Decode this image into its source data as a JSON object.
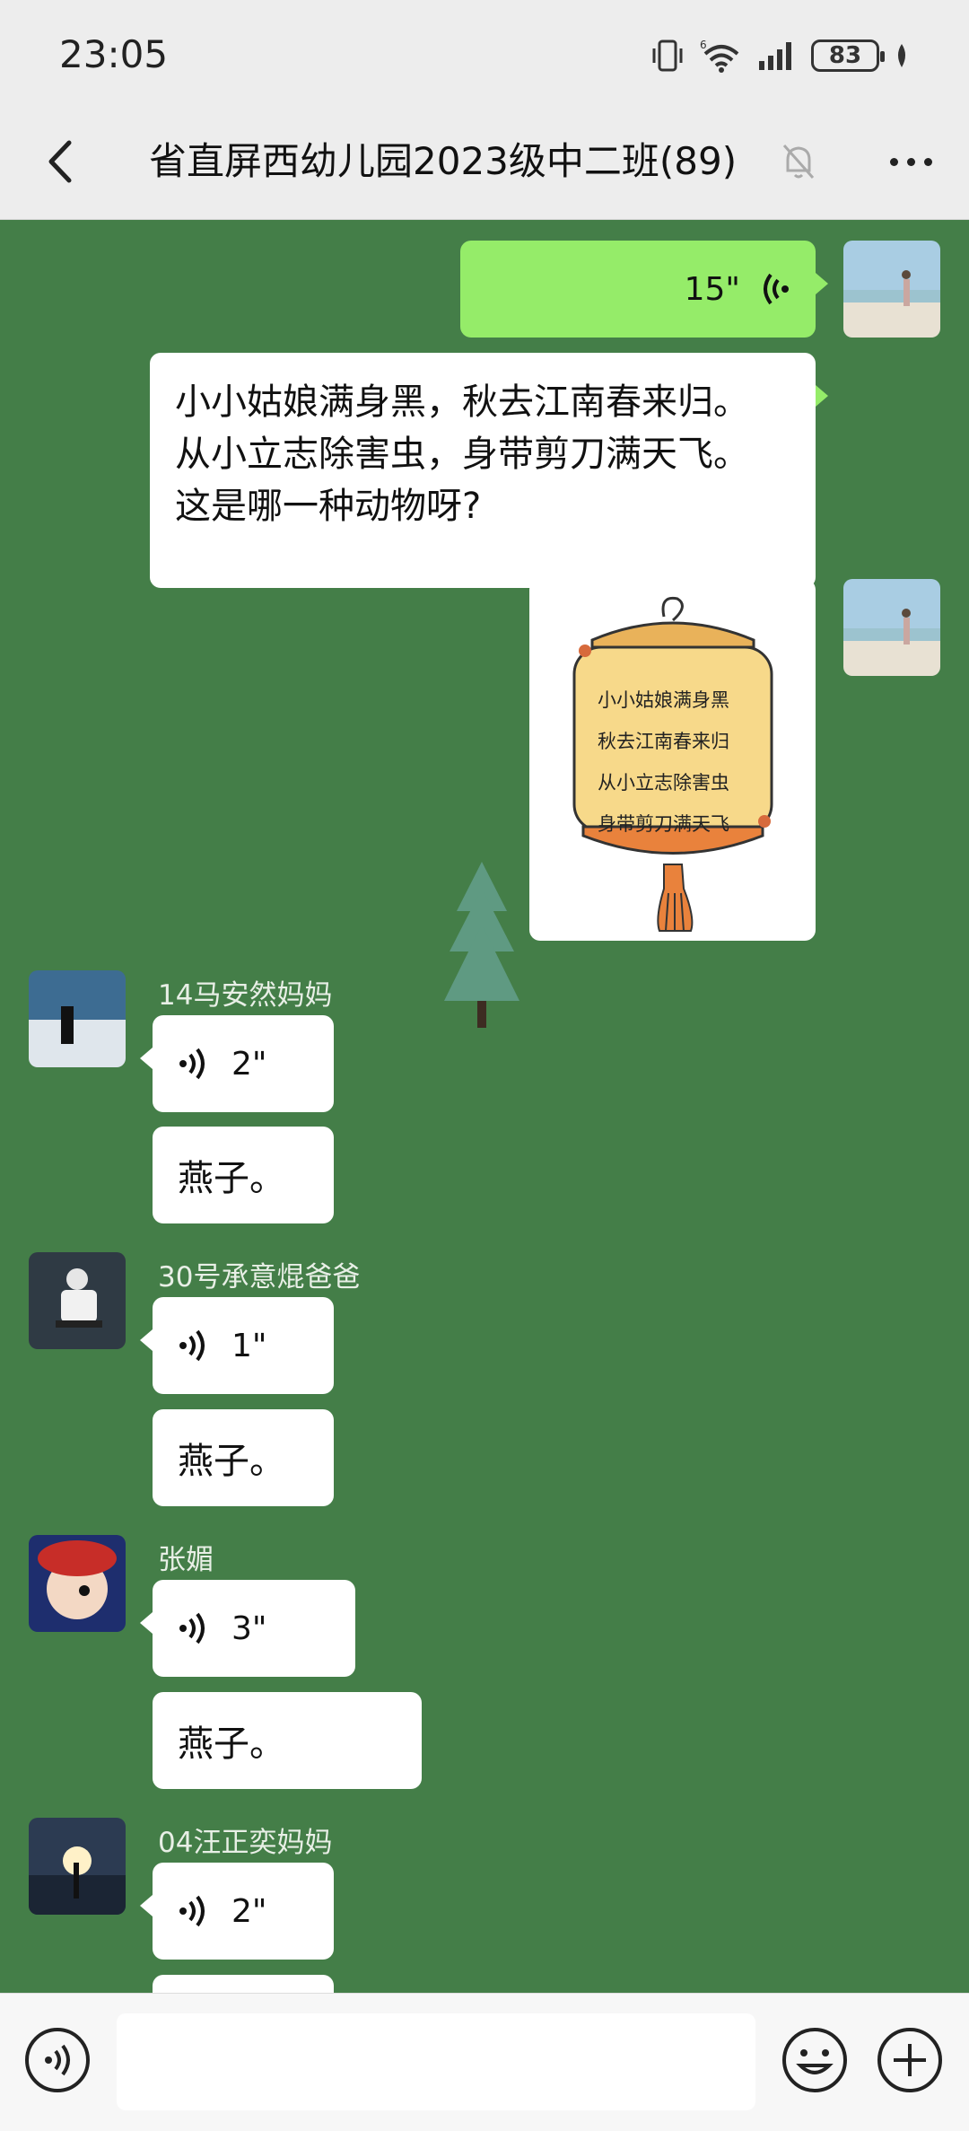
{
  "status": {
    "time": "23:05",
    "battery": "83"
  },
  "header": {
    "title": "省直屏西幼儿园2023级中二班(89)"
  },
  "messages": {
    "self_voice": {
      "duration": "15\""
    },
    "riddle": {
      "line1": "小小姑娘满身黑，秋去江南春来归。",
      "line2": "从小立志除害虫，身带剪刀满天飞。",
      "line3": "这是哪一种动物呀?"
    },
    "lantern": {
      "line1": "小小姑娘满身黑",
      "line2": "秋去江南春来归",
      "line3": "从小立志除害虫",
      "line4": "身带剪刀满天飞"
    },
    "m1": {
      "sender": "14马安然妈妈",
      "voice": "2\"",
      "text": "燕子。"
    },
    "m2": {
      "sender": "30号承意焜爸爸",
      "voice": "1\"",
      "text": "燕子。"
    },
    "m3": {
      "sender": "张媚",
      "voice": "3\"",
      "text": "燕子。"
    },
    "m4": {
      "sender": "04汪正奕妈妈",
      "voice": "2\""
    }
  },
  "icons": {
    "back": "chevron-left-icon",
    "mute": "bell-off-icon",
    "more": "more-dots-icon",
    "voice_input": "voice-input-icon",
    "emoji": "emoji-icon",
    "plus": "plus-icon"
  },
  "colors": {
    "chat_bg": "#447e48",
    "self_bubble": "#95ec69",
    "bar_bg": "#ededed"
  }
}
